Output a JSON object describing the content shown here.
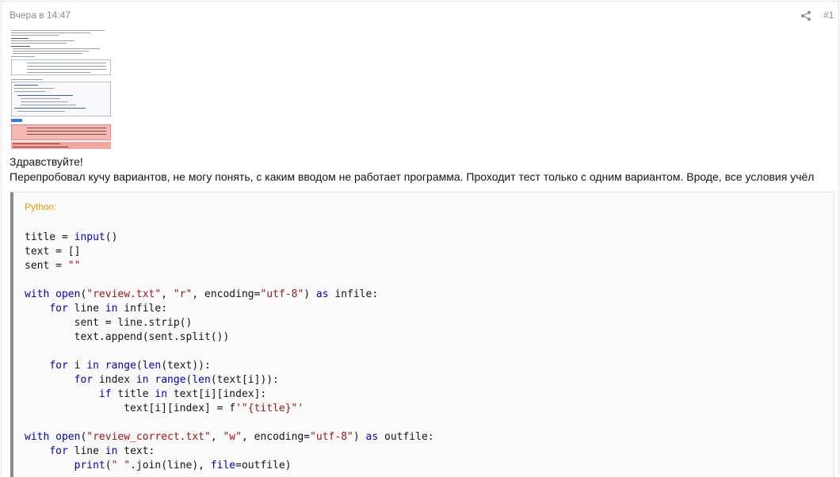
{
  "post": {
    "timestamp": "Вчера в 14:47",
    "number": "#1",
    "share_icon": "share-icon",
    "paragraphs": [
      "Здравствуйте!",
      "Перепробовал кучу вариантов, не могу понять, с каким вводом не работает программа. Проходит тест только с одним вариантом. Вроде, все условия учёл"
    ]
  },
  "code_block": {
    "language": "Python:",
    "lines": [
      "title = input()",
      "text = []",
      "sent = \"\"",
      "",
      "with open(\"review.txt\", \"r\", encoding=\"utf-8\") as infile:",
      "    for line in infile:",
      "        sent = line.strip()",
      "        text.append(sent.split())",
      "",
      "    for i in range(len(text)):",
      "        for index in range(len(text[i])):",
      "            if title in text[i][index]:",
      "                text[i][index] = f'\"{title}\"'",
      "",
      "with open(\"review_correct.txt\", \"w\", encoding=\"utf-8\") as outfile:",
      "    for line in text:",
      "        print(\" \".join(line), file=outfile)"
    ]
  },
  "colors": {
    "keyword": "#0000c8",
    "string": "#a31515",
    "language_label": "#e79b00",
    "meta_text": "#8c8c8c"
  }
}
